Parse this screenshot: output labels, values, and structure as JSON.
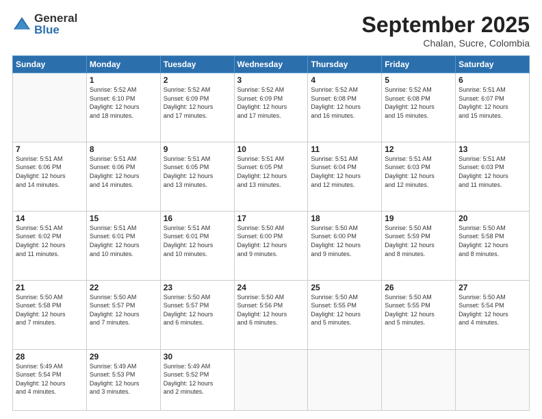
{
  "header": {
    "logo_general": "General",
    "logo_blue": "Blue",
    "month_title": "September 2025",
    "location": "Chalan, Sucre, Colombia"
  },
  "days_of_week": [
    "Sunday",
    "Monday",
    "Tuesday",
    "Wednesday",
    "Thursday",
    "Friday",
    "Saturday"
  ],
  "weeks": [
    [
      {
        "day": "",
        "info": ""
      },
      {
        "day": "1",
        "info": "Sunrise: 5:52 AM\nSunset: 6:10 PM\nDaylight: 12 hours\nand 18 minutes."
      },
      {
        "day": "2",
        "info": "Sunrise: 5:52 AM\nSunset: 6:09 PM\nDaylight: 12 hours\nand 17 minutes."
      },
      {
        "day": "3",
        "info": "Sunrise: 5:52 AM\nSunset: 6:09 PM\nDaylight: 12 hours\nand 17 minutes."
      },
      {
        "day": "4",
        "info": "Sunrise: 5:52 AM\nSunset: 6:08 PM\nDaylight: 12 hours\nand 16 minutes."
      },
      {
        "day": "5",
        "info": "Sunrise: 5:52 AM\nSunset: 6:08 PM\nDaylight: 12 hours\nand 15 minutes."
      },
      {
        "day": "6",
        "info": "Sunrise: 5:51 AM\nSunset: 6:07 PM\nDaylight: 12 hours\nand 15 minutes."
      }
    ],
    [
      {
        "day": "7",
        "info": "Sunrise: 5:51 AM\nSunset: 6:06 PM\nDaylight: 12 hours\nand 14 minutes."
      },
      {
        "day": "8",
        "info": "Sunrise: 5:51 AM\nSunset: 6:06 PM\nDaylight: 12 hours\nand 14 minutes."
      },
      {
        "day": "9",
        "info": "Sunrise: 5:51 AM\nSunset: 6:05 PM\nDaylight: 12 hours\nand 13 minutes."
      },
      {
        "day": "10",
        "info": "Sunrise: 5:51 AM\nSunset: 6:05 PM\nDaylight: 12 hours\nand 13 minutes."
      },
      {
        "day": "11",
        "info": "Sunrise: 5:51 AM\nSunset: 6:04 PM\nDaylight: 12 hours\nand 12 minutes."
      },
      {
        "day": "12",
        "info": "Sunrise: 5:51 AM\nSunset: 6:03 PM\nDaylight: 12 hours\nand 12 minutes."
      },
      {
        "day": "13",
        "info": "Sunrise: 5:51 AM\nSunset: 6:03 PM\nDaylight: 12 hours\nand 11 minutes."
      }
    ],
    [
      {
        "day": "14",
        "info": "Sunrise: 5:51 AM\nSunset: 6:02 PM\nDaylight: 12 hours\nand 11 minutes."
      },
      {
        "day": "15",
        "info": "Sunrise: 5:51 AM\nSunset: 6:01 PM\nDaylight: 12 hours\nand 10 minutes."
      },
      {
        "day": "16",
        "info": "Sunrise: 5:51 AM\nSunset: 6:01 PM\nDaylight: 12 hours\nand 10 minutes."
      },
      {
        "day": "17",
        "info": "Sunrise: 5:50 AM\nSunset: 6:00 PM\nDaylight: 12 hours\nand 9 minutes."
      },
      {
        "day": "18",
        "info": "Sunrise: 5:50 AM\nSunset: 6:00 PM\nDaylight: 12 hours\nand 9 minutes."
      },
      {
        "day": "19",
        "info": "Sunrise: 5:50 AM\nSunset: 5:59 PM\nDaylight: 12 hours\nand 8 minutes."
      },
      {
        "day": "20",
        "info": "Sunrise: 5:50 AM\nSunset: 5:58 PM\nDaylight: 12 hours\nand 8 minutes."
      }
    ],
    [
      {
        "day": "21",
        "info": "Sunrise: 5:50 AM\nSunset: 5:58 PM\nDaylight: 12 hours\nand 7 minutes."
      },
      {
        "day": "22",
        "info": "Sunrise: 5:50 AM\nSunset: 5:57 PM\nDaylight: 12 hours\nand 7 minutes."
      },
      {
        "day": "23",
        "info": "Sunrise: 5:50 AM\nSunset: 5:57 PM\nDaylight: 12 hours\nand 6 minutes."
      },
      {
        "day": "24",
        "info": "Sunrise: 5:50 AM\nSunset: 5:56 PM\nDaylight: 12 hours\nand 6 minutes."
      },
      {
        "day": "25",
        "info": "Sunrise: 5:50 AM\nSunset: 5:55 PM\nDaylight: 12 hours\nand 5 minutes."
      },
      {
        "day": "26",
        "info": "Sunrise: 5:50 AM\nSunset: 5:55 PM\nDaylight: 12 hours\nand 5 minutes."
      },
      {
        "day": "27",
        "info": "Sunrise: 5:50 AM\nSunset: 5:54 PM\nDaylight: 12 hours\nand 4 minutes."
      }
    ],
    [
      {
        "day": "28",
        "info": "Sunrise: 5:49 AM\nSunset: 5:54 PM\nDaylight: 12 hours\nand 4 minutes."
      },
      {
        "day": "29",
        "info": "Sunrise: 5:49 AM\nSunset: 5:53 PM\nDaylight: 12 hours\nand 3 minutes."
      },
      {
        "day": "30",
        "info": "Sunrise: 5:49 AM\nSunset: 5:52 PM\nDaylight: 12 hours\nand 2 minutes."
      },
      {
        "day": "",
        "info": ""
      },
      {
        "day": "",
        "info": ""
      },
      {
        "day": "",
        "info": ""
      },
      {
        "day": "",
        "info": ""
      }
    ]
  ]
}
